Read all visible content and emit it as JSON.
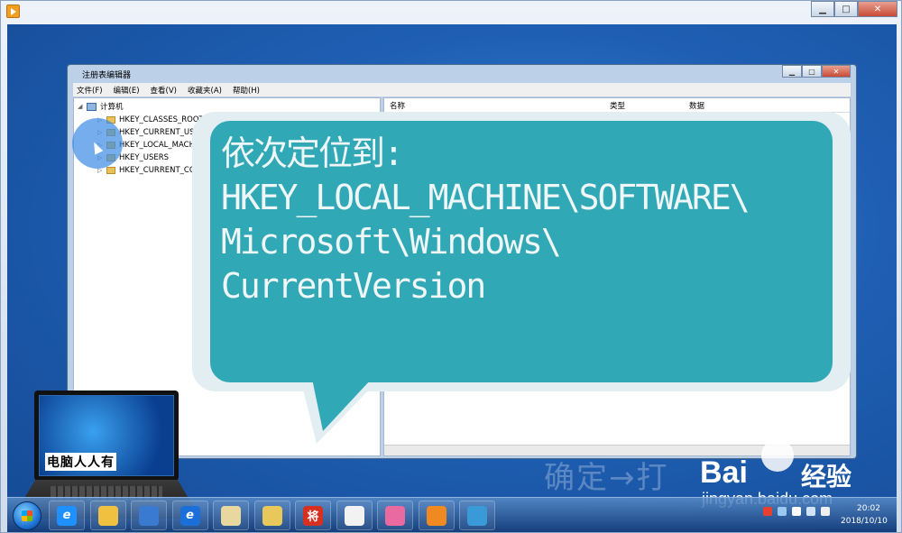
{
  "regedit": {
    "title": "注册表编辑器",
    "menu": [
      "文件(F)",
      "编辑(E)",
      "查看(V)",
      "收藏夹(A)",
      "帮助(H)"
    ],
    "tree": {
      "root": "计算机",
      "items": [
        "HKEY_CLASSES_ROOT",
        "HKEY_CURRENT_USER",
        "HKEY_LOCAL_MACHINE",
        "HKEY_USERS",
        "HKEY_CURRENT_CONFIG"
      ]
    },
    "columns": [
      "名称",
      "类型",
      "数据"
    ]
  },
  "bubble": {
    "lines": [
      "依次定位到:",
      "HKEY_LOCAL_MACHINE\\SOFTWARE\\",
      "Microsoft\\Windows\\",
      "CurrentVersion"
    ]
  },
  "logo": {
    "caption": "电脑人人有"
  },
  "watermark": {
    "text": "确定→打",
    "baidu": "Bai",
    "jingyan": "经验",
    "url": "jingyan.baidu.com"
  },
  "taskbar": {
    "apps": [
      {
        "name": "ie-icon",
        "glyph": "e",
        "color": "#1e90ff"
      },
      {
        "name": "explorer-icon",
        "glyph": "",
        "color": "#f0c040"
      },
      {
        "name": "media-icon",
        "glyph": "",
        "color": "#3a7ad0"
      },
      {
        "name": "ie-icon-2",
        "glyph": "e",
        "color": "#1a70d8"
      },
      {
        "name": "paint-icon",
        "glyph": "",
        "color": "#e8d8a0"
      },
      {
        "name": "folder-app-icon",
        "glyph": "",
        "color": "#e8c85a"
      },
      {
        "name": "jiang-app-icon",
        "glyph": "将",
        "color": "#d83020"
      },
      {
        "name": "pinwheel-icon",
        "glyph": "",
        "color": "#f2f2f2"
      },
      {
        "name": "qq-game-icon",
        "glyph": "",
        "color": "#e86aa0"
      },
      {
        "name": "player-app-icon",
        "glyph": "",
        "color": "#f08a20"
      },
      {
        "name": "regedit-app-icon",
        "glyph": "",
        "color": "#3a9ad8"
      }
    ],
    "clock": {
      "time": "20:02",
      "date": "2018/10/10"
    }
  }
}
